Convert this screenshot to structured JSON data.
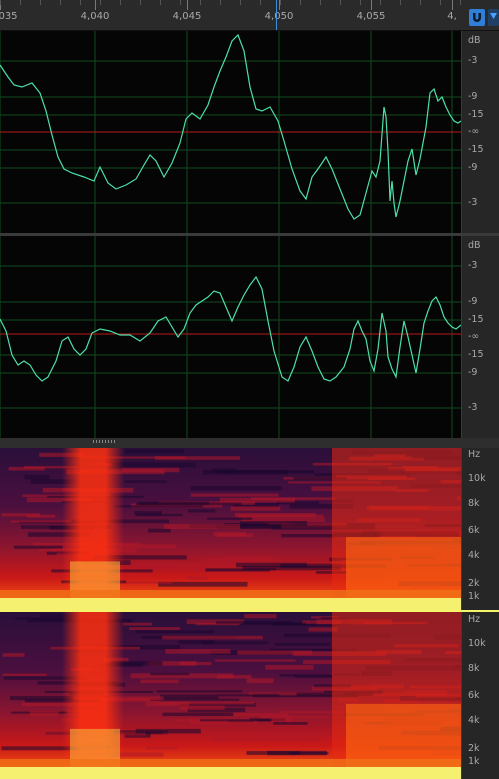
{
  "ruler": {
    "ticks": [
      {
        "label": "035",
        "pos": 0.0
      },
      {
        "label": "4,040",
        "pos": 0.205
      },
      {
        "label": "4,045",
        "pos": 0.405
      },
      {
        "label": "4,050",
        "pos": 0.605
      },
      {
        "label": "4,055",
        "pos": 0.805
      },
      {
        "label": "4,",
        "pos": 0.98
      }
    ],
    "playhead_pos": 0.598
  },
  "toolbar": {
    "snap_icon": "magnet-icon",
    "marker_icon": "playhead-marker-icon",
    "accent": "#2f7fd8"
  },
  "waveform": {
    "colors": {
      "wave": "#4de0a8",
      "zero_line": "#b81a1a",
      "grid": "#0f4a1f",
      "background": "#050505"
    },
    "channel_top": {
      "scale": [
        {
          "label": "dB"
        },
        {
          "label": "-3"
        },
        {
          "label": "-9"
        },
        {
          "label": "-15"
        },
        {
          "label": "-∞"
        },
        {
          "label": "-15"
        },
        {
          "label": "-9"
        },
        {
          "label": "-3"
        }
      ]
    },
    "channel_bottom": {
      "scale": [
        {
          "label": "dB"
        },
        {
          "label": "-3"
        },
        {
          "label": "-9"
        },
        {
          "label": "-15"
        },
        {
          "label": "-∞"
        },
        {
          "label": "-15"
        },
        {
          "label": "-9"
        },
        {
          "label": "-3"
        }
      ]
    }
  },
  "spectral": {
    "channel_top": {
      "scale": [
        {
          "label": "Hz"
        },
        {
          "label": "10k"
        },
        {
          "label": "8k"
        },
        {
          "label": "6k"
        },
        {
          "label": "4k"
        },
        {
          "label": "2k"
        },
        {
          "label": "1k"
        }
      ]
    },
    "channel_bottom": {
      "scale": [
        {
          "label": "Hz"
        },
        {
          "label": "10k"
        },
        {
          "label": "8k"
        },
        {
          "label": "6k"
        },
        {
          "label": "4k"
        },
        {
          "label": "2k"
        },
        {
          "label": "1k"
        }
      ]
    }
  }
}
